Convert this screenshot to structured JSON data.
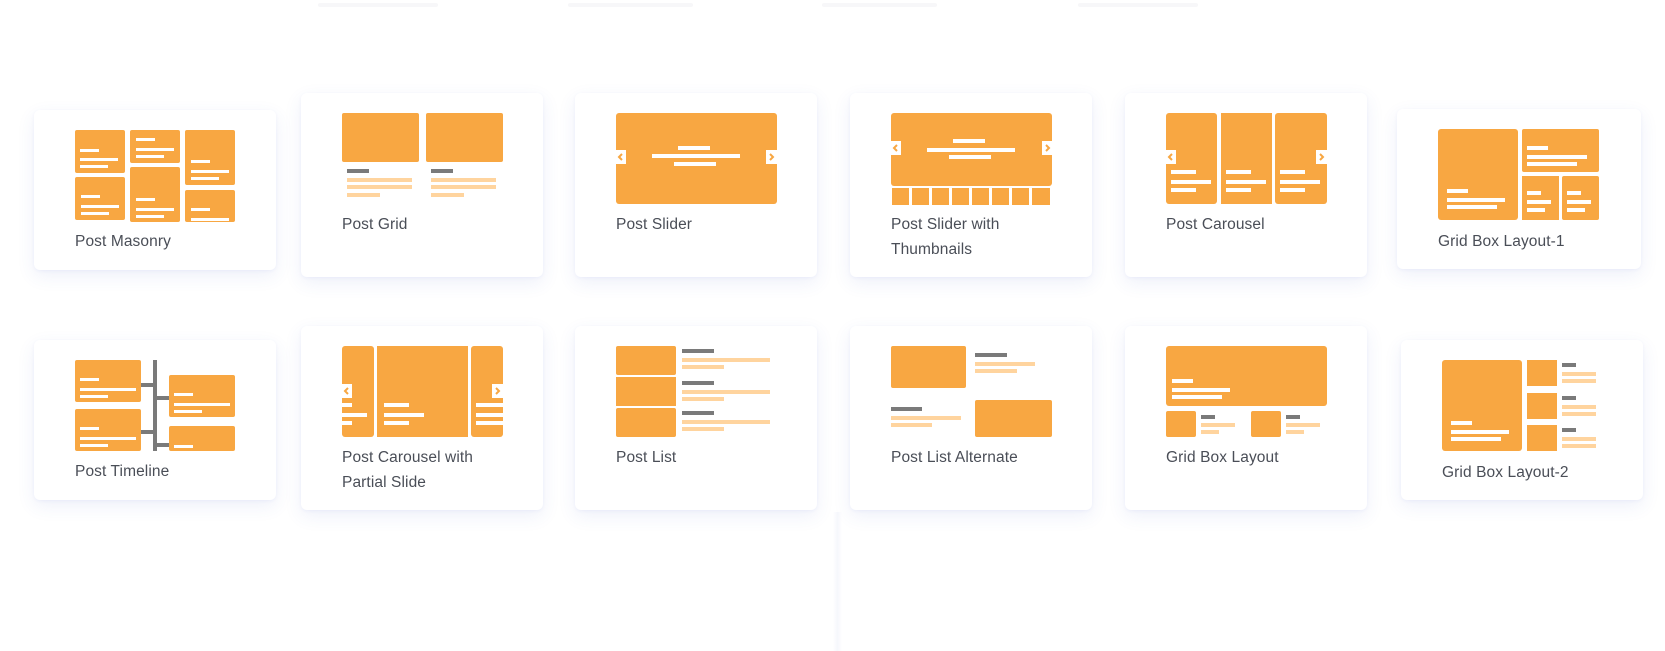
{
  "colors": {
    "accent": "#F8A742",
    "accent_light": "#FFD49E",
    "meta_gray": "#7A7A7A",
    "label_text": "#4A4E57",
    "card_bg": "#FFFFFF"
  },
  "layouts": [
    {
      "id": "post-masonry",
      "label": "Post Masonry",
      "icon": "masonry-layout-icon"
    },
    {
      "id": "post-grid",
      "label": "Post Grid",
      "icon": "grid-layout-icon"
    },
    {
      "id": "post-slider",
      "label": "Post Slider",
      "icon": "slider-layout-icon"
    },
    {
      "id": "post-slider-thumbnails",
      "label": "Post Slider with Thumbnails",
      "icon": "slider-thumbnails-layout-icon"
    },
    {
      "id": "post-carousel",
      "label": "Post Carousel",
      "icon": "carousel-layout-icon"
    },
    {
      "id": "grid-box-layout-1",
      "label": "Grid Box Layout-1",
      "icon": "grid-box-1-layout-icon"
    },
    {
      "id": "post-timeline",
      "label": "Post Timeline",
      "icon": "timeline-layout-icon"
    },
    {
      "id": "post-carousel-partial",
      "label": "Post Carousel with Partial Slide",
      "icon": "carousel-partial-layout-icon"
    },
    {
      "id": "post-list",
      "label": "Post List",
      "icon": "list-layout-icon"
    },
    {
      "id": "post-list-alternate",
      "label": "Post List Alternate",
      "icon": "list-alternate-layout-icon"
    },
    {
      "id": "grid-box-layout",
      "label": "Grid Box Layout",
      "icon": "grid-box-layout-icon"
    },
    {
      "id": "grid-box-layout-2",
      "label": "Grid Box Layout-2",
      "icon": "grid-box-2-layout-icon"
    }
  ]
}
